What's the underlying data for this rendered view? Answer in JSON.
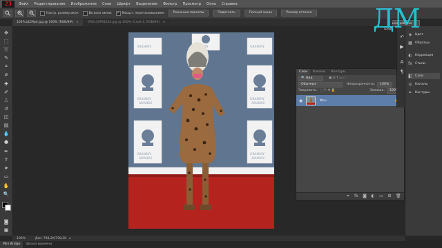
{
  "app": {
    "logo_text": "23"
  },
  "menu": [
    "Файл",
    "Редактирование",
    "Изображение",
    "Слои",
    "Шрифт",
    "Выделение",
    "Фильтр",
    "Просмотр",
    "Окно",
    "Справка"
  ],
  "options": {
    "check1": "Настр. размер окон",
    "check2": "Во всех окнах",
    "check3": "Масшт. перетаскиванием",
    "btn1": "Реальные пикселы",
    "btn2": "Подогнать",
    "btn3": "Полный экран",
    "btn4": "Размер оттиска"
  },
  "tabs": [
    {
      "label": "104Fca129p4.jpg @ 100% (RGB/8#)",
      "active": true
    },
    {
      "label": "VRSx10PS1524.jpg @ 100% (Слой 1, RGB/8#)",
      "active": false
    }
  ],
  "workspace": "Основная рабочая среда",
  "layers_panel": {
    "tabs": [
      "Слои",
      "Каналы",
      "Контуры"
    ],
    "kind": "Вид",
    "blend": "Обычные",
    "opacity_label": "Непрозрачность:",
    "opacity": "100%",
    "lock_label": "Закрепить:",
    "fill_label": "Заливка:",
    "fill": "100%",
    "layer_name": "Фон"
  },
  "dock": [
    "Цвет",
    "Образцы",
    "Коррекция",
    "Стили",
    "Слои",
    "Каналы",
    "Контуры"
  ],
  "status": {
    "zoom": "100%",
    "doc": "Док: 798,2К/798,2К"
  },
  "bottom_tabs": [
    "Mini Bridge",
    "Шкала времени"
  ],
  "watermark": "ДМ",
  "colors": {
    "accent": "#27bfd0",
    "layer_selected": "#5d7eaa"
  }
}
